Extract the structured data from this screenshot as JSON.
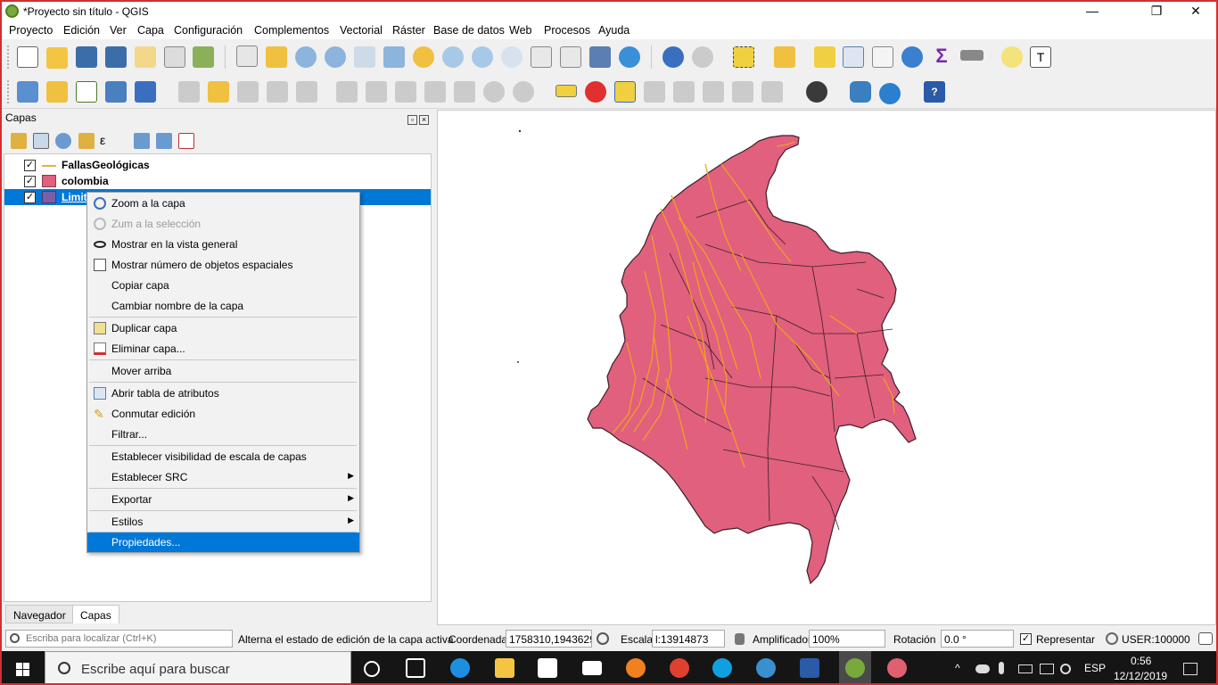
{
  "window": {
    "title": "*Proyecto sin título - QGIS",
    "minimize": "—",
    "maximize": "❐",
    "close": "✕"
  },
  "menu": [
    "Proyecto",
    "Edición",
    "Ver",
    "Capa",
    "Configuración",
    "Complementos",
    "Vectorial",
    "Ráster",
    "Base de datos",
    "Web",
    "Procesos",
    "Ayuda"
  ],
  "layers_panel": {
    "title": "Capas",
    "layers": [
      {
        "name": "FallasGeológicas",
        "checked": "✓",
        "symbol": "line",
        "color": "#e8b04c"
      },
      {
        "name": "colombia",
        "checked": "✓",
        "symbol": "fill",
        "color": "#e0607e"
      },
      {
        "name": "Limit",
        "checked": "✓",
        "symbol": "fill",
        "color": "#7b5ea7"
      }
    ],
    "tabs": [
      "Navegador",
      "Capas"
    ],
    "active_tab": "Capas"
  },
  "context_menu": {
    "items": [
      {
        "label": "Zoom a la capa",
        "icon": "zoom-layer-icon",
        "enabled": true
      },
      {
        "label": "Zum a la selección",
        "icon": "zoom-selection-icon",
        "enabled": false
      },
      {
        "label": "Mostrar en la vista general",
        "icon": "overview-icon",
        "enabled": true
      },
      {
        "label": "Mostrar número de objetos espaciales",
        "icon": "checkbox-icon",
        "enabled": true
      },
      {
        "label": "Copiar capa",
        "enabled": true
      },
      {
        "label": "Cambiar nombre de la capa",
        "enabled": true
      },
      {
        "label": "Duplicar capa",
        "icon": "duplicate-icon",
        "enabled": true
      },
      {
        "label": "Eliminar capa...",
        "icon": "remove-layer-icon",
        "enabled": true
      },
      {
        "label": "Mover arriba",
        "enabled": true
      },
      {
        "label": "Abrir tabla de atributos",
        "icon": "attribute-table-icon",
        "enabled": true
      },
      {
        "label": "Conmutar edición",
        "icon": "pencil-icon",
        "enabled": true
      },
      {
        "label": "Filtrar...",
        "enabled": true
      },
      {
        "label": "Establecer visibilidad de escala de capas",
        "enabled": true
      },
      {
        "label": "Establecer SRC",
        "submenu": true,
        "enabled": true
      },
      {
        "label": "Exportar",
        "submenu": true,
        "enabled": true
      },
      {
        "label": "Estilos",
        "submenu": true,
        "enabled": true
      },
      {
        "label": "Propiedades...",
        "enabled": true,
        "highlighted": true
      }
    ],
    "submenu_arrow": "▶"
  },
  "map": {
    "fill_color": "#e0607e",
    "boundary_color": "#3a2028",
    "fault_color": "#f0a020"
  },
  "status": {
    "locator_placeholder": "Escriba para localizar (Ctrl+K)",
    "message": "Alterna el estado de edición de la capa activa",
    "coord_label": "Coordenada",
    "coord_value": "1758310,1943629",
    "scale_label": "Escala",
    "scale_value": "l:13914873",
    "magnifier_label": "Amplificador",
    "magnifier_value": "100%",
    "rotation_label": "Rotación",
    "rotation_value": "0.0 °",
    "render_label": "Representar",
    "render_checked": "✓",
    "crs": "USER:100000"
  },
  "taskbar": {
    "search_placeholder": "Escribe aquí para buscar",
    "language": "ESP",
    "time": "0:56",
    "date": "12/12/2019"
  }
}
